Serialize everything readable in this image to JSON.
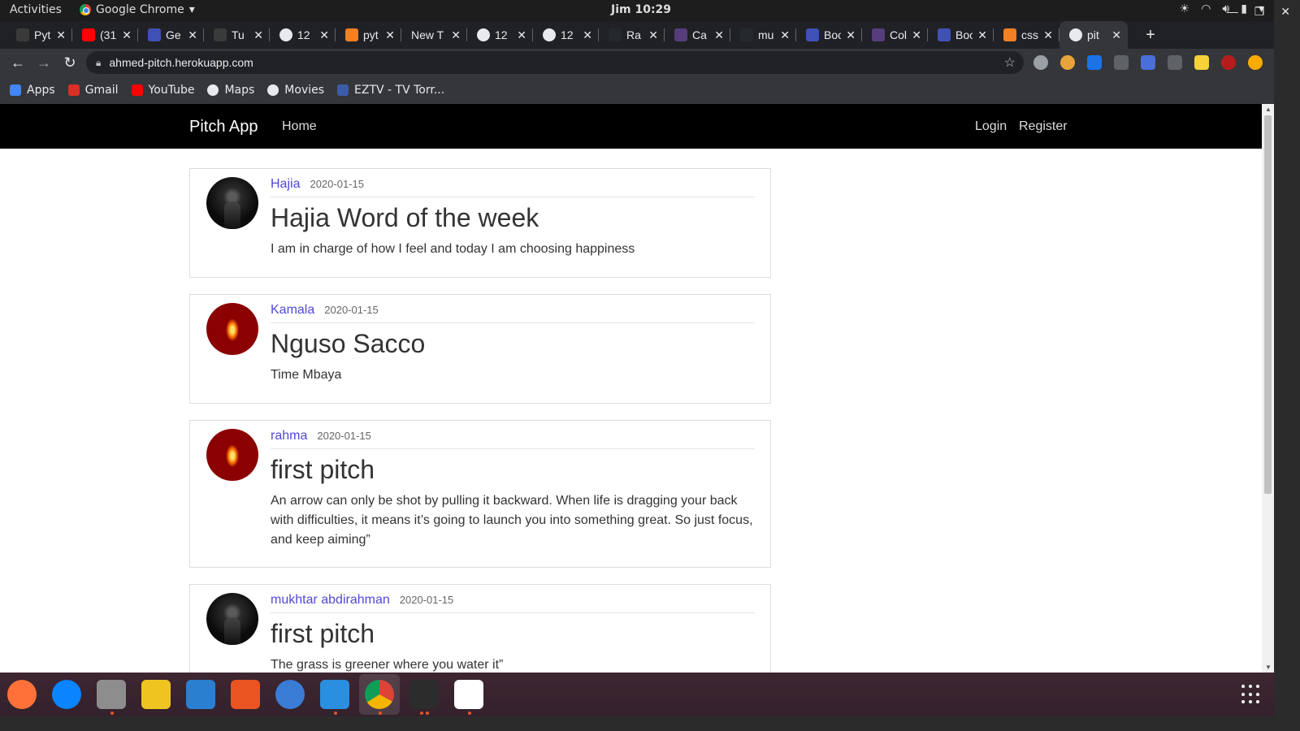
{
  "system": {
    "activities_label": "Activities",
    "app_name": "Google Chrome",
    "clock": "Jim 10:29"
  },
  "tabs": [
    {
      "label": "Pyt",
      "icon": "flask-icon",
      "color": "#3a3a3a"
    },
    {
      "label": "(31",
      "icon": "youtube-icon",
      "color": "#ff0000"
    },
    {
      "label": "Ge",
      "icon": "mdb-icon",
      "color": "#3f51b5"
    },
    {
      "label": "Tu",
      "icon": "flask-icon",
      "color": "#3a3a3a"
    },
    {
      "label": "12",
      "icon": "globe-icon",
      "color": "#e8eaed"
    },
    {
      "label": "pyt",
      "icon": "stackoverflow-icon",
      "color": "#f48024"
    },
    {
      "label": "New T",
      "icon": "",
      "color": ""
    },
    {
      "label": "12",
      "icon": "globe-icon",
      "color": "#e8eaed"
    },
    {
      "label": "12",
      "icon": "globe-icon",
      "color": "#e8eaed"
    },
    {
      "label": "Ra",
      "icon": "github-icon",
      "color": "#24292e"
    },
    {
      "label": "Ca",
      "icon": "bootstrap-icon",
      "color": "#563d7c"
    },
    {
      "label": "mu",
      "icon": "github-icon",
      "color": "#24292e"
    },
    {
      "label": "Boots",
      "icon": "mdb-icon",
      "color": "#3f51b5"
    },
    {
      "label": "Colors",
      "icon": "bootstrap-icon",
      "color": "#563d7c"
    },
    {
      "label": "Boots",
      "icon": "mdb-icon",
      "color": "#3f51b5"
    },
    {
      "label": "css - B",
      "icon": "stackoverflow-icon",
      "color": "#f48024"
    },
    {
      "label": "pit",
      "icon": "globe-icon",
      "color": "#e8eaed",
      "active": true
    }
  ],
  "url": "ahmed-pitch.herokuapp.com",
  "bookmarks": [
    {
      "label": "Apps",
      "icon": "apps-grid-icon",
      "color": "#4285f4"
    },
    {
      "label": "Gmail",
      "icon": "gmail-icon",
      "color": "#d93025"
    },
    {
      "label": "YouTube",
      "icon": "youtube-icon",
      "color": "#ff0000"
    },
    {
      "label": "Maps",
      "icon": "globe-icon",
      "color": "#e8eaed"
    },
    {
      "label": "Movies",
      "icon": "globe-icon",
      "color": "#e8eaed"
    },
    {
      "label": "EZTV - TV Torr...",
      "icon": "eztv-icon",
      "color": "#3b5ca8"
    }
  ],
  "site": {
    "brand": "Pitch App",
    "nav": {
      "home": "Home",
      "login": "Login",
      "register": "Register"
    }
  },
  "pitches": [
    {
      "author": "Hajia",
      "date": "2020-01-15",
      "title": "Hajia Word of the week",
      "body": "I am in charge of how I feel and today I am choosing happiness",
      "avatar": "panther"
    },
    {
      "author": "Kamala",
      "date": "2020-01-15",
      "title": "Nguso Sacco",
      "body": "Time Mbaya",
      "avatar": "fire"
    },
    {
      "author": "rahma",
      "date": "2020-01-15",
      "title": "first pitch",
      "body": "An arrow can only be shot by pulling it backward. When life is dragging your back with difficulties, it means it’s going to launch you into something great. So just focus, and keep aiming”",
      "avatar": "fire"
    },
    {
      "author": "mukhtar abdirahman",
      "date": "2020-01-15",
      "title": "first pitch",
      "body": "The grass is greener where you water it”",
      "avatar": "panther"
    }
  ],
  "dock": [
    {
      "name": "firefox-icon",
      "color": "#ff7139"
    },
    {
      "name": "thunderbird-icon",
      "color": "#0a84ff"
    },
    {
      "name": "files-icon",
      "color": "#8d8d8d"
    },
    {
      "name": "rhythmbox-icon",
      "color": "#f0c420"
    },
    {
      "name": "libreoffice-writer-icon",
      "color": "#2a7fd1"
    },
    {
      "name": "software-center-icon",
      "color": "#e95420"
    },
    {
      "name": "help-icon",
      "color": "#3a7bd5"
    },
    {
      "name": "vscode-icon",
      "color": "#2b8fe0"
    },
    {
      "name": "chrome-icon",
      "color": "#4285f4"
    },
    {
      "name": "terminal-icon",
      "color": "#2c2c2c"
    },
    {
      "name": "slack-icon",
      "color": "#ffffff"
    }
  ]
}
